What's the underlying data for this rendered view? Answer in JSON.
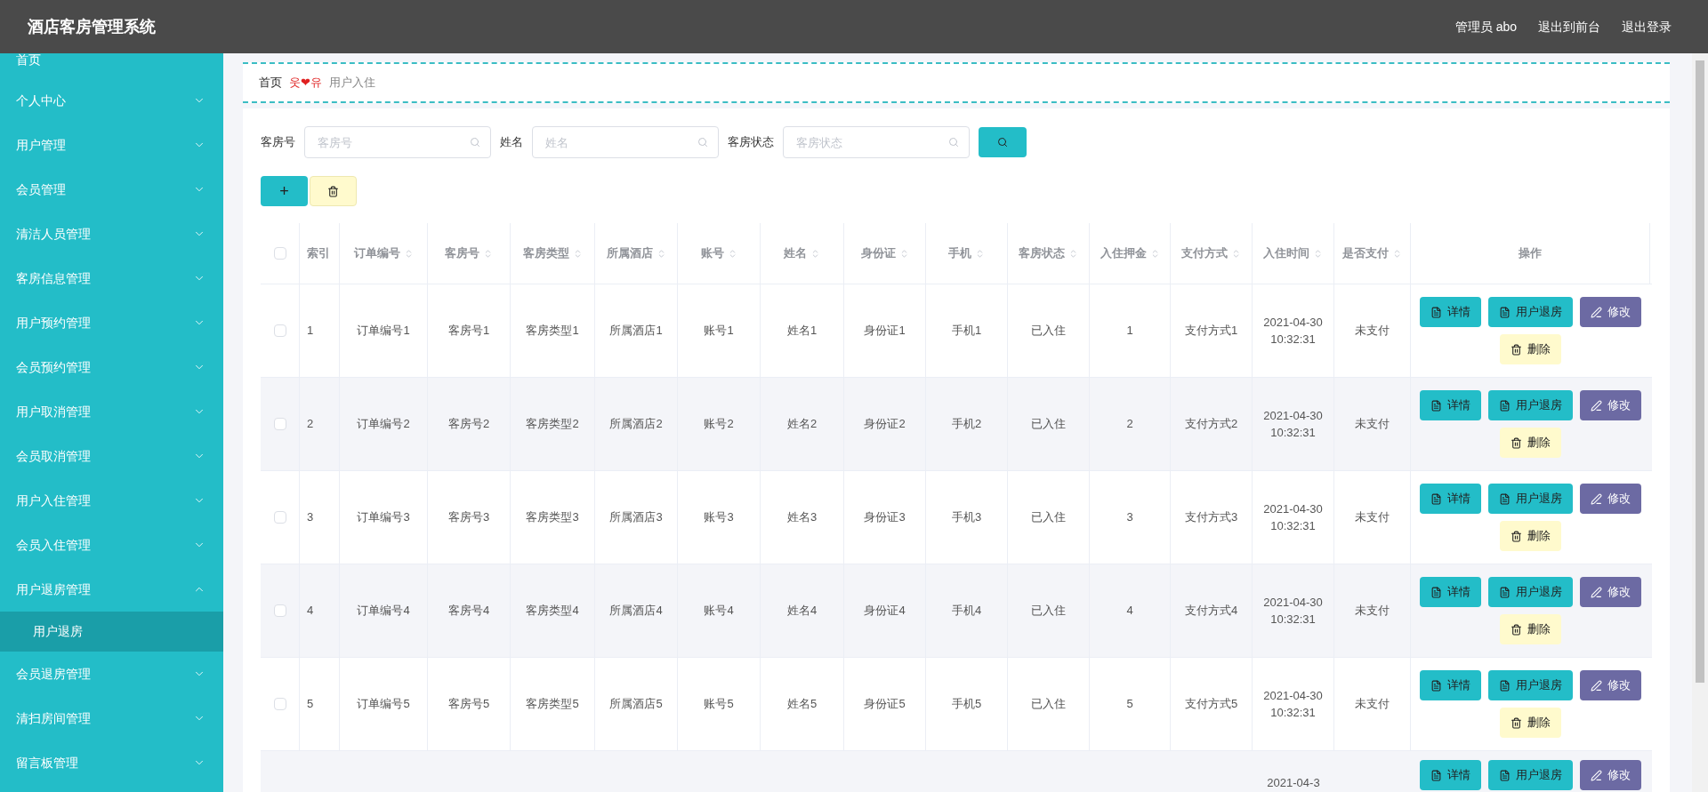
{
  "header": {
    "title": "酒店客房管理系统",
    "links": [
      "管理员 abo",
      "退出到前台",
      "退出登录"
    ]
  },
  "sidebar": {
    "items": [
      {
        "kind": "link",
        "label": "首页"
      },
      {
        "kind": "menu",
        "label": "个人中心",
        "expanded": false
      },
      {
        "kind": "menu",
        "label": "用户管理",
        "expanded": false
      },
      {
        "kind": "menu",
        "label": "会员管理",
        "expanded": false
      },
      {
        "kind": "menu",
        "label": "清洁人员管理",
        "expanded": false
      },
      {
        "kind": "menu",
        "label": "客房信息管理",
        "expanded": false
      },
      {
        "kind": "menu",
        "label": "用户预约管理",
        "expanded": false
      },
      {
        "kind": "menu",
        "label": "会员预约管理",
        "expanded": false
      },
      {
        "kind": "menu",
        "label": "用户取消管理",
        "expanded": false
      },
      {
        "kind": "menu",
        "label": "会员取消管理",
        "expanded": false
      },
      {
        "kind": "menu",
        "label": "用户入住管理",
        "expanded": false
      },
      {
        "kind": "menu",
        "label": "会员入住管理",
        "expanded": false
      },
      {
        "kind": "menu",
        "label": "用户退房管理",
        "expanded": true,
        "children": [
          {
            "label": "用户退房",
            "selected": true
          }
        ]
      },
      {
        "kind": "menu",
        "label": "会员退房管理",
        "expanded": false
      },
      {
        "kind": "menu",
        "label": "清扫房间管理",
        "expanded": false
      },
      {
        "kind": "menu",
        "label": "留言板管理",
        "expanded": false
      }
    ]
  },
  "breadcrumb": {
    "home": "首页",
    "separator": "웃❤유",
    "current": "用户入住"
  },
  "search": {
    "fields": [
      {
        "label": "客房号",
        "placeholder": "客房号"
      },
      {
        "label": "姓名",
        "placeholder": "姓名"
      },
      {
        "label": "客房状态",
        "placeholder": "客房状态"
      }
    ]
  },
  "toolbar": {
    "add": "+"
  },
  "table": {
    "all_checked": false,
    "columns": [
      {
        "label": "索引",
        "sortable": false
      },
      {
        "label": "订单编号",
        "sortable": true
      },
      {
        "label": "客房号",
        "sortable": true
      },
      {
        "label": "客房类型",
        "sortable": true
      },
      {
        "label": "所属酒店",
        "sortable": true
      },
      {
        "label": "账号",
        "sortable": true
      },
      {
        "label": "姓名",
        "sortable": true
      },
      {
        "label": "身份证",
        "sortable": true
      },
      {
        "label": "手机",
        "sortable": true
      },
      {
        "label": "客房状态",
        "sortable": true
      },
      {
        "label": "入住押金",
        "sortable": true
      },
      {
        "label": "支付方式",
        "sortable": true
      },
      {
        "label": "入住时间",
        "sortable": true
      },
      {
        "label": "是否支付",
        "sortable": true
      },
      {
        "label": "操作",
        "sortable": false
      }
    ],
    "rows": [
      {
        "checked": false,
        "cells": [
          "1",
          "订单编号1",
          "客房号1",
          "客房类型1",
          "所属酒店1",
          "账号1",
          "姓名1",
          "身份证1",
          "手机1",
          "已入住",
          "1",
          "支付方式1",
          "2021-04-30 10:32:31",
          "未支付"
        ],
        "actions": [
          "详情",
          "用户退房",
          "修改",
          "删除"
        ]
      },
      {
        "checked": false,
        "cells": [
          "2",
          "订单编号2",
          "客房号2",
          "客房类型2",
          "所属酒店2",
          "账号2",
          "姓名2",
          "身份证2",
          "手机2",
          "已入住",
          "2",
          "支付方式2",
          "2021-04-30 10:32:31",
          "未支付"
        ],
        "actions": [
          "详情",
          "用户退房",
          "修改",
          "删除"
        ]
      },
      {
        "checked": false,
        "cells": [
          "3",
          "订单编号3",
          "客房号3",
          "客房类型3",
          "所属酒店3",
          "账号3",
          "姓名3",
          "身份证3",
          "手机3",
          "已入住",
          "3",
          "支付方式3",
          "2021-04-30 10:32:31",
          "未支付"
        ],
        "actions": [
          "详情",
          "用户退房",
          "修改",
          "删除"
        ]
      },
      {
        "checked": false,
        "cells": [
          "4",
          "订单编号4",
          "客房号4",
          "客房类型4",
          "所属酒店4",
          "账号4",
          "姓名4",
          "身份证4",
          "手机4",
          "已入住",
          "4",
          "支付方式4",
          "2021-04-30 10:32:31",
          "未支付"
        ],
        "actions": [
          "详情",
          "用户退房",
          "修改",
          "删除"
        ]
      },
      {
        "checked": false,
        "cells": [
          "5",
          "订单编号5",
          "客房号5",
          "客房类型5",
          "所属酒店5",
          "账号5",
          "姓名5",
          "身份证5",
          "手机5",
          "已入住",
          "5",
          "支付方式5",
          "2021-04-30 10:32:31",
          "未支付"
        ],
        "actions": [
          "详情",
          "用户退房",
          "修改",
          "删除"
        ]
      }
    ],
    "partial_row": {
      "time": "2021-04-3",
      "actions": [
        "详情",
        "用户退房",
        "修改"
      ]
    }
  }
}
